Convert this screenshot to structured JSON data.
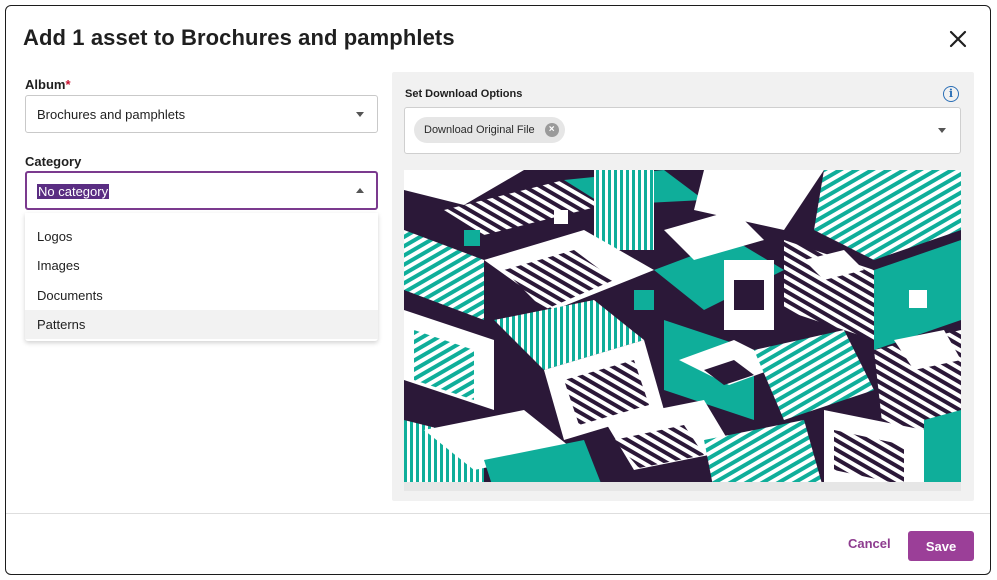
{
  "dialog": {
    "title": "Add 1 asset to Brochures and pamphlets",
    "close_icon": "close-icon"
  },
  "album": {
    "label": "Album",
    "required_marker": "*",
    "value": "Brochures and pamphlets"
  },
  "category": {
    "label": "Category",
    "value": "No category",
    "options": [
      "Logos",
      "Images",
      "Documents",
      "Patterns"
    ],
    "hovered_option": "Patterns"
  },
  "download": {
    "label": "Set Download Options",
    "info_icon": "info-icon",
    "chip_label": "Download Original File"
  },
  "preview": {
    "image": "isometric-pattern-preview",
    "colors": {
      "dark": "#2b1838",
      "teal": "#0fae9a",
      "light": "#ffffff"
    }
  },
  "footer": {
    "cancel_label": "Cancel",
    "save_label": "Save"
  },
  "colors": {
    "accent": "#9b3f98",
    "focus_border": "#7b3a8e",
    "info": "#2b6fb6",
    "required": "#c8102e"
  }
}
